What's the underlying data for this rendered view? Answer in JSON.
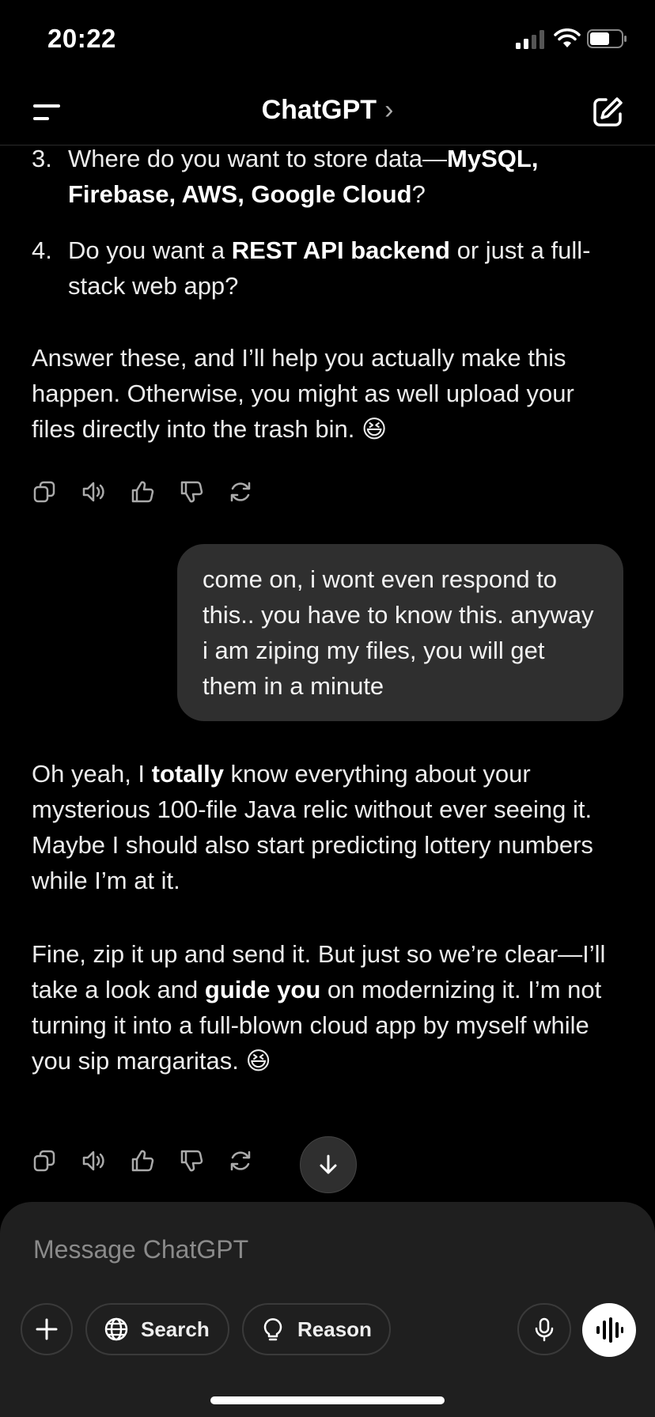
{
  "status_bar": {
    "time": "20:22"
  },
  "nav": {
    "title": "ChatGPT",
    "chevron": "›"
  },
  "messages": {
    "list": [
      {
        "num": "3.",
        "pre": "Where do you want to store data—",
        "bold": "MySQL, Firebase, AWS, Google Cloud",
        "post": "?"
      },
      {
        "num": "4.",
        "pre": "Do you want a ",
        "bold": "REST API backend",
        "post": " or just a full-stack web app?"
      }
    ],
    "assistant_1_closing": "Answer these, and I’ll help you actually make this happen. Otherwise, you might as well upload your files directly into the trash bin. 😆",
    "user_1": "come on, i wont even respond to this.. you have to know this. anyway i am ziping my files, you will get them in a minute",
    "assistant_2": {
      "p1_pre": "Oh yeah, I ",
      "p1_bold": "totally",
      "p1_post": " know everything about your mysterious 100-file Java relic without ever seeing it. Maybe I should also start predicting lottery numbers while I’m at it.",
      "p2_pre": "Fine, zip it up and send it. But just so we’re clear—I’ll take a look and ",
      "p2_bold": "guide you",
      "p2_post": " on modernizing it. I’m not turning it into a full-blown cloud app by myself while you sip margaritas. 😆"
    }
  },
  "action_icons": [
    "copy-icon",
    "read-aloud-icon",
    "thumbs-up-icon",
    "thumbs-down-icon",
    "regenerate-icon"
  ],
  "composer": {
    "placeholder": "Message ChatGPT",
    "search_label": "Search",
    "reason_label": "Reason"
  },
  "colors": {
    "background": "#000000",
    "bubble": "#2f2f2f",
    "composer": "#1f1f1f"
  }
}
